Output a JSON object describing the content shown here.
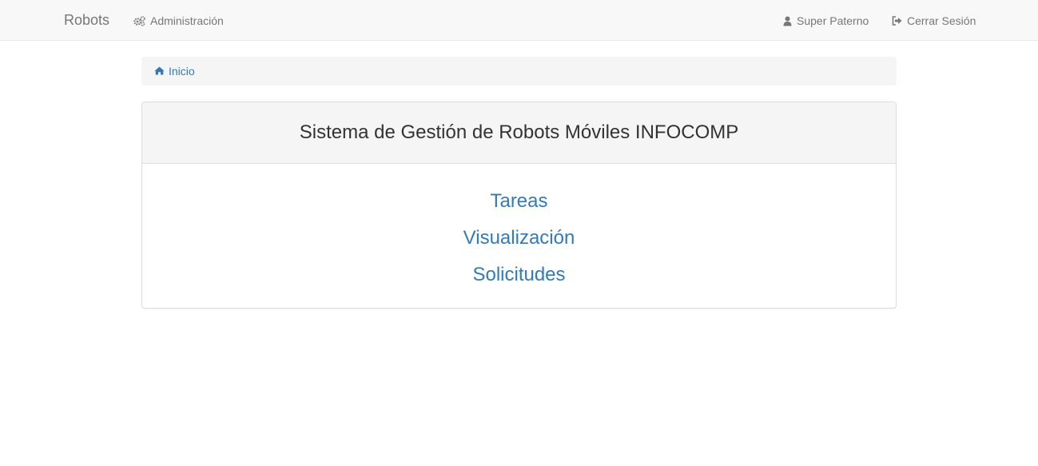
{
  "navbar": {
    "brand": "Robots",
    "admin_label": "Administración",
    "admin_icon": "cogs-icon",
    "user_label": "Super Paterno",
    "user_icon": "user-icon",
    "logout_label": "Cerrar Sesión",
    "logout_icon": "sign-out-icon"
  },
  "breadcrumb": {
    "home_label": "Inicio",
    "home_icon": "home-icon"
  },
  "panel": {
    "title": "Sistema de Gestión de Robots Móviles INFOCOMP",
    "links": [
      {
        "label": "Tareas"
      },
      {
        "label": "Visualización"
      },
      {
        "label": "Solicitudes"
      }
    ]
  },
  "colors": {
    "link": "#337ab7",
    "navbar_text": "#777777",
    "navbar_bg": "#f8f8f8",
    "panel_heading_bg": "#f5f5f5"
  }
}
